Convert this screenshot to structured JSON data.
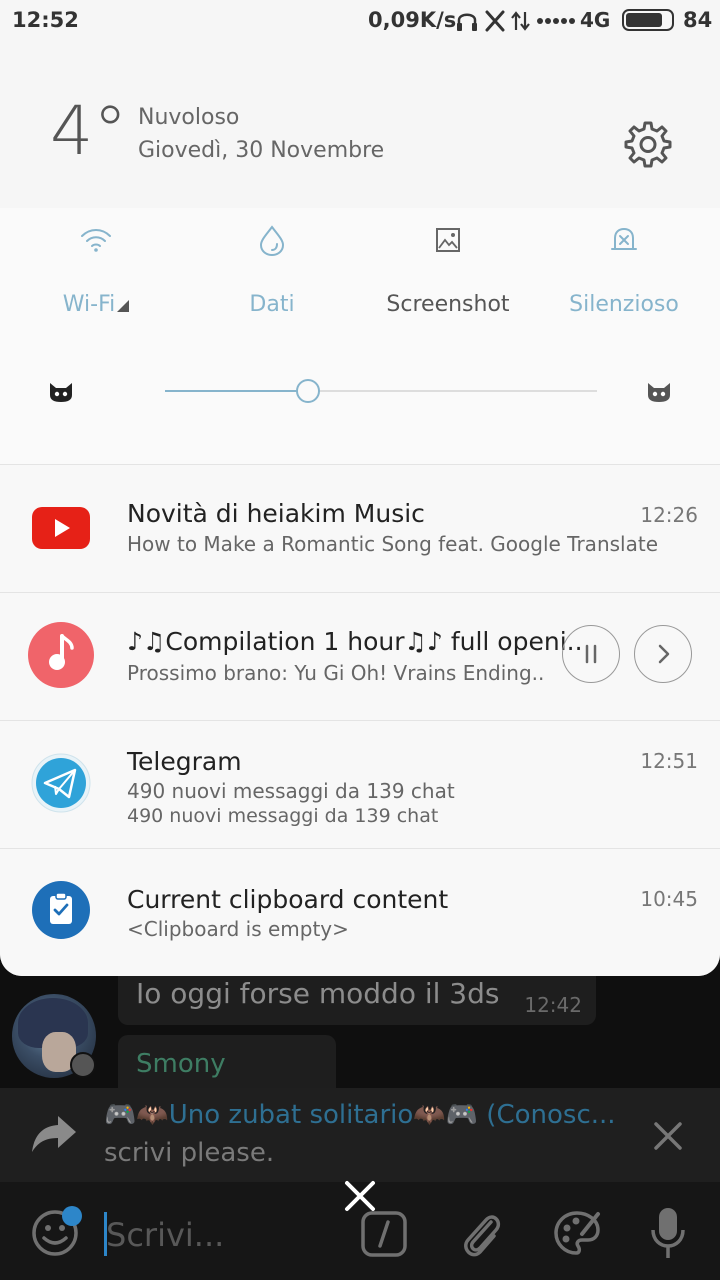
{
  "status_bar": {
    "time": "12:52",
    "net_speed": "0,09K/s",
    "network": "4G",
    "battery_percent": "84",
    "battery_level": 0.84,
    "icons": [
      "headphones-icon",
      "bluetooth-x-icon",
      "data-arrows-icon",
      "signal-dots-icon"
    ]
  },
  "weather": {
    "temperature": "4°",
    "condition": "Nuvoloso",
    "date": "Giovedì, 30 Novembre",
    "settings_icon": "gear-icon"
  },
  "toggles": [
    {
      "label": "Wi-Fi",
      "icon": "wifi-icon",
      "active": true
    },
    {
      "label": "Dati",
      "icon": "droplet-icon",
      "active": true
    },
    {
      "label": "Screenshot",
      "icon": "image-icon",
      "active": false
    },
    {
      "label": "Silenzioso",
      "icon": "silent-bell-icon",
      "active": true
    }
  ],
  "brightness": {
    "level": 0.33,
    "low_icon": "cat-face-icon",
    "high_icon": "cat-face-icon"
  },
  "notifications": {
    "youtube": {
      "title": "Novità di heiakim Music",
      "subtitle": "How to Make a Romantic Song feat. Google Translate",
      "time": "12:26",
      "icon": "youtube-icon"
    },
    "music": {
      "title": "♪♫Compilation 1 hour♫♪ full openi..",
      "subtitle": "Prossimo brano: Yu Gi Oh! Vrains Ending..",
      "icon": "music-note-icon",
      "controls": [
        "pause-icon",
        "next-icon"
      ]
    },
    "telegram": {
      "title": "Telegram",
      "line1": "490 nuovi messaggi da 139 chat",
      "line2": "490 nuovi messaggi da 139 chat",
      "time": "12:51",
      "icon": "telegram-icon"
    },
    "clipboard": {
      "title": "Current clipboard content",
      "subtitle": "<Clipboard is empty>",
      "time": "10:45",
      "icon": "clipboard-check-icon"
    }
  },
  "chat": {
    "message_text": "Io oggi forse moddo il 3ds",
    "message_time": "12:42",
    "sender_name": "Smony",
    "reply_name": "🎮🦇Uno zubat solitario🦇🎮 (Conosc...",
    "reply_text": "scrivi please.",
    "input_placeholder": "Scrivi...",
    "colors": {
      "accent": "#2d86c9",
      "sender": "#3e7d63"
    }
  }
}
